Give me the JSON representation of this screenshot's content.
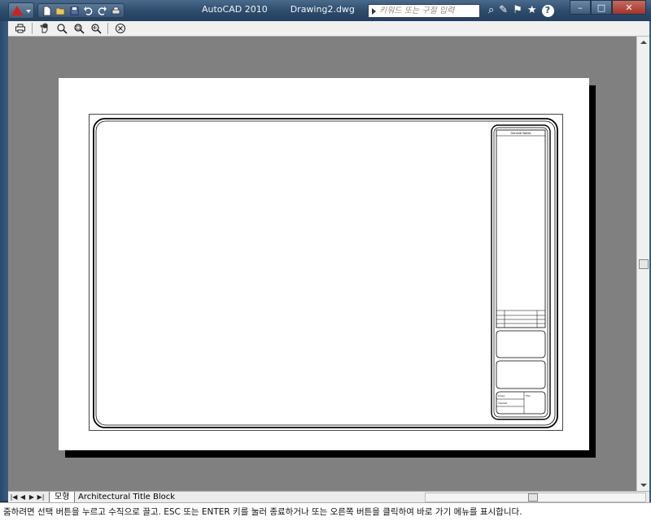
{
  "titlebar": {
    "app_name": "AutoCAD 2010",
    "document": "Drawing2.dwg",
    "search_placeholder": "키워드 또는 구절 입력",
    "icons": [
      "binoculars-icon",
      "tools-icon",
      "sign-in-icon",
      "star-icon",
      "help-icon"
    ]
  },
  "quick_access": [
    "new-icon",
    "open-icon",
    "save-icon",
    "undo-icon",
    "redo-icon",
    "plot-icon"
  ],
  "toolbar": {
    "icons": [
      "plot-icon",
      "pan-icon",
      "zoom-realtime-icon",
      "zoom-window-icon",
      "zoom-previous-icon",
      "close-preview-icon"
    ]
  },
  "titleblock": {
    "general_notes": "General Notes",
    "drawn": "Drawn",
    "checked": "Checked",
    "title": "Title"
  },
  "tabs": {
    "model": "모형",
    "layout": "Architectural Title Block"
  },
  "command_line": "줌하려면 선택 버튼을 누르고 수직으로 끌고. ESC 또는 ENTER 키를 눌러 종료하거나 또는 오른쪽 버튼을 클릭하여 바로 가기 메뉴를 표시합니다."
}
